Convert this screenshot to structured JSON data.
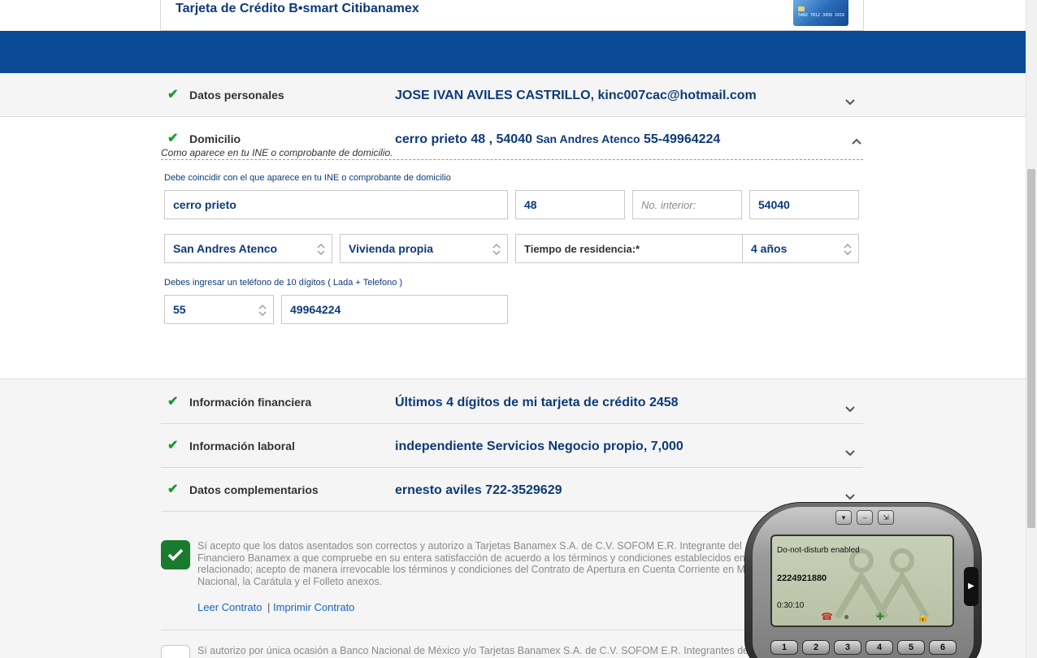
{
  "header": {
    "title": "Tarjeta de Crédito B•smart Citibanamex",
    "card_number": "5482 7812 3456 1010"
  },
  "sections": {
    "personal": {
      "label": "Datos personales",
      "summary": "JOSE IVAN AVILES CASTRILLO, kinc007cac@hotmail.com"
    },
    "domicilio": {
      "label": "Domicilio",
      "summary_main": "cerro prieto 48 , 54040",
      "summary_small": "San Andres Atenco",
      "summary_phone": "55-49964224",
      "hint_italic": "Como aparece en tu INE o comprobante de domicilio.",
      "hint_match": "Debe coincidir con el que aparece en tu INE o comprobante de domicilio",
      "fields": {
        "street": "cerro prieto",
        "ext_number": "48",
        "int_number_placeholder": "No. interior:",
        "zip": "54040",
        "municipality": "San Andres Atenco",
        "housing": "Vivienda propia",
        "residence_label": "Tiempo de residencia:*",
        "residence_value": "4 años",
        "phone_hint": "Debes ingresar un teléfono de 10 dígitos ( Lada + Telefono )",
        "lada": "55",
        "phone": "49964224"
      }
    },
    "financial": {
      "label": "Información financiera",
      "summary": "Últimos 4 dígitos de mi tarjeta de crédito 2458"
    },
    "labor": {
      "label": "Información laboral",
      "summary": "independiente Servicios Negocio propio, 7,000"
    },
    "complementary": {
      "label": "Datos complementarios",
      "summary": "ernesto aviles 722-3529629"
    }
  },
  "consent": {
    "text1_line1": "Sí acepto que los datos asentados son correctos y autorizo a Tarjetas Banamex S.A. de C.V. SOFOM E.R. Integrante del",
    "text1_line2": "Financiero Banamex a que compruebe en su entera satisfacción de acuerdo a los términos y condiciones establecidos en",
    "text1_line3": "relacionado; acepto de manera irrevocable los términos y condiciones del Contrato de Apertura en Cuenta Corriente en M",
    "text1_line4": "Nacional, la Carátula y el Folleto anexos.",
    "read_contract": "Leer Contrato",
    "separator": "|",
    "print_contract": "Imprimir Contrato",
    "text2": "Sí autorizo por única ocasión a Banco Nacional de México y/o Tarjetas Banamex S.A. de C.V. SOFOM E.R. Integrantes de"
  },
  "softphone": {
    "status": "Do-not-disturb enabled",
    "number": "2224921880",
    "timer": "0:30:10",
    "keys": [
      "1",
      "2",
      "3",
      "4",
      "5",
      "6"
    ]
  },
  "colors": {
    "brand_blue": "#0a4a94",
    "check_green": "#1a9a2f",
    "text_navy": "#0d3a7a"
  }
}
